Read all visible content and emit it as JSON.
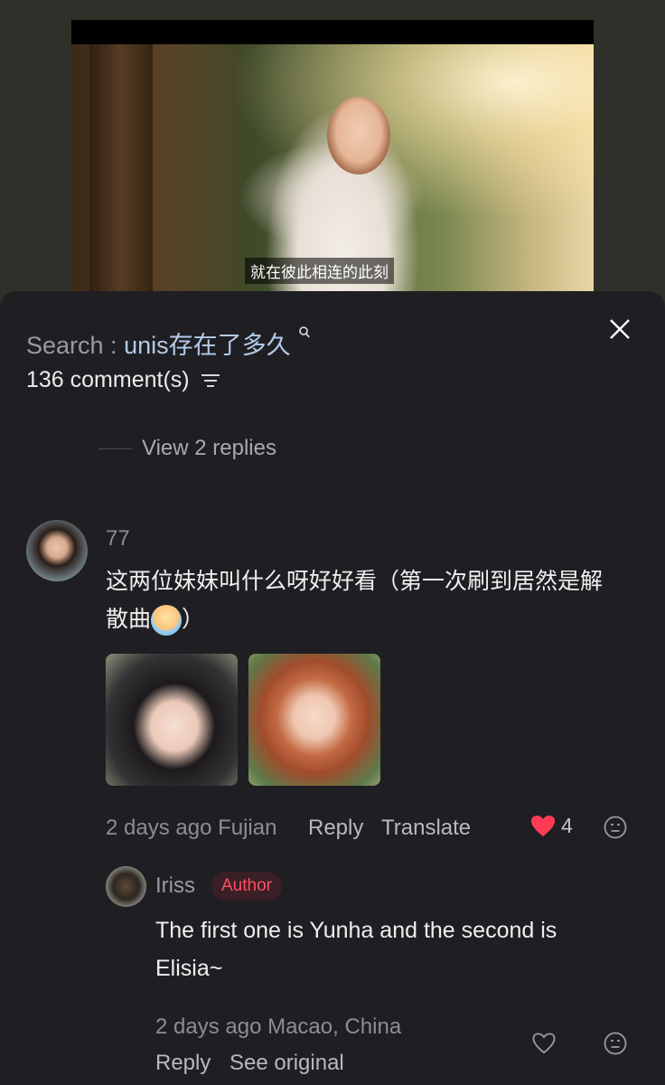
{
  "video": {
    "subtitle": "就在彼此相连的此刻"
  },
  "search": {
    "prefix": "Search : ",
    "query": "unis存在了多久",
    "icon": "search-icon"
  },
  "comments_header": {
    "count_label": "136 comment(s)",
    "filter_icon": "filter-icon",
    "close_icon": "close-icon"
  },
  "view_replies_label": "View 2 replies",
  "comment": {
    "username": "77",
    "text_line1": "这两位妹妹叫什么呀好好看（第一次刷到居然是解",
    "text_line2_prefix": "散曲",
    "text_line2_suffix": "）",
    "time": "2 days ago",
    "location": "Fujian",
    "reply_label": "Reply",
    "translate_label": "Translate",
    "like_count": "4",
    "liked": true
  },
  "reply": {
    "username": "Iriss",
    "badge": "Author",
    "text": "The first one is Yunha and the second is Elisia~",
    "time": "2 days ago",
    "location": "Macao, China",
    "reply_label": "Reply",
    "see_original_label": "See original"
  },
  "colors": {
    "background": "#2f3029",
    "panel": "#1f1f23",
    "like_red": "#ff3b55",
    "badge_text": "#ff4f62",
    "query_blue": "#b4cbe8"
  }
}
